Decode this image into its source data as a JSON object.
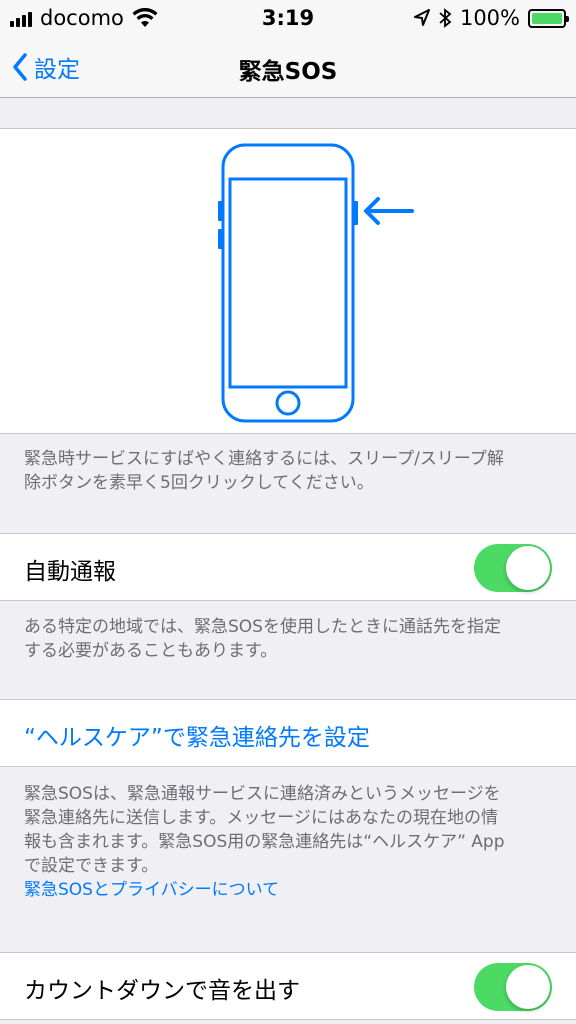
{
  "status_bar": {
    "carrier": "docomo",
    "time": "3:19",
    "battery_percent": "100%",
    "battery_level": 1.0,
    "icons": [
      "signal-icon",
      "wifi-icon",
      "location-icon",
      "bluetooth-icon",
      "battery-icon"
    ]
  },
  "nav": {
    "back_label": "設定",
    "title": "緊急SOS"
  },
  "illustration": {
    "icon": "iphone-side-button-icon",
    "accent": "#007aff"
  },
  "illustration_footer": {
    "line1": "緊急時サービスにすばやく連絡するには、スリープ/スリープ解",
    "line2": "除ボタンを素早く5回クリックしてください。"
  },
  "auto_call": {
    "label": "自動通報",
    "enabled": true,
    "footer_line1": "ある特定の地域では、緊急SOSを使用したときに通話先を指定",
    "footer_line2": "する必要があることもあります。"
  },
  "health_link": {
    "label": "“ヘルスケア”で緊急連絡先を設定"
  },
  "info_footer": {
    "line1": "緊急SOSは、緊急通報サービスに連絡済みというメッセージを",
    "line2": "緊急連絡先に送信します。メッセージにはあなたの現在地の情",
    "line3": "報も含まれます。緊急SOS用の緊急連絡先は“ヘルスケア” App",
    "line4": "で設定できます。",
    "privacy_link": "緊急SOSとプライバシーについて"
  },
  "countdown_sound": {
    "label": "カウントダウンで音を出す",
    "enabled": true
  },
  "colors": {
    "accent": "#007aff",
    "toggle_on": "#4cd964",
    "background": "#efeff4"
  }
}
